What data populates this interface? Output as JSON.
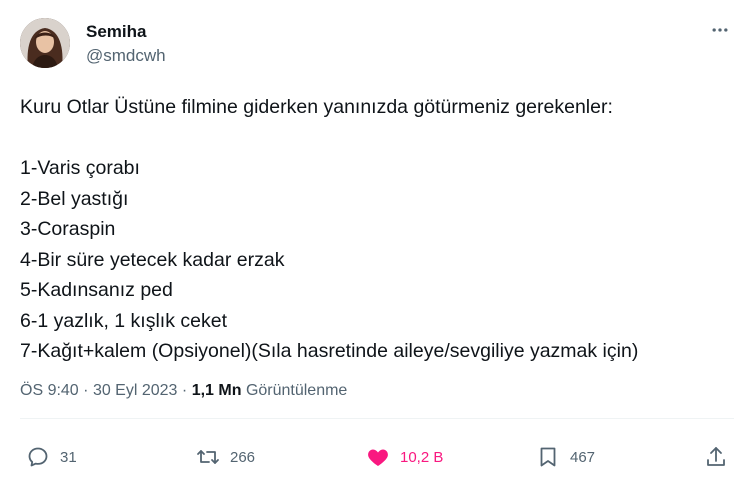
{
  "author": {
    "display_name": "Semiha",
    "handle": "@smdcwh"
  },
  "tweet": {
    "intro": "Kuru Otlar Üstüne filmine giderken yanınızda götürmeniz gerekenler:",
    "items": [
      "1-Varis çorabı",
      "2-Bel yastığı",
      "3-Coraspin",
      "4-Bir süre yetecek kadar erzak",
      "5-Kadınsanız ped",
      "6-1 yazlık, 1 kışlık ceket",
      "7-Kağıt+kalem (Opsiyonel)(Sıla hasretinde aileye/sevgiliye yazmak için)"
    ]
  },
  "meta": {
    "time": "ÖS 9:40",
    "separator": "·",
    "date": "30 Eyl 2023",
    "views_count": "1,1 Mn",
    "views_label": "Görüntülenme"
  },
  "actions": {
    "reply_count": "31",
    "retweet_count": "266",
    "like_count": "10,2 B",
    "bookmark_count": "467"
  },
  "colors": {
    "text": "#0f1419",
    "secondary": "#536471",
    "like": "#f91880",
    "divider": "#eff3f4"
  },
  "icons": {
    "more": "more-icon",
    "reply": "reply-icon",
    "retweet": "retweet-icon",
    "like": "heart-icon",
    "bookmark": "bookmark-icon",
    "share": "share-icon"
  }
}
